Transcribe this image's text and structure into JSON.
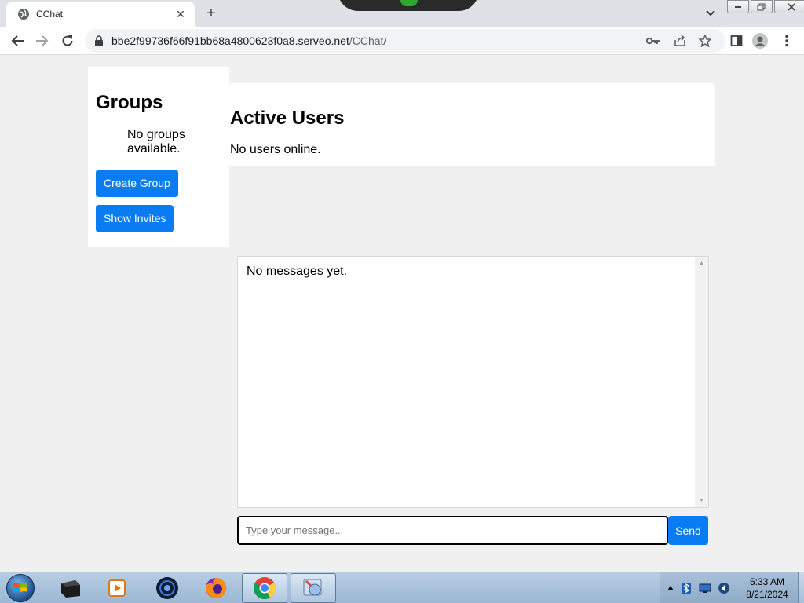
{
  "browser": {
    "tab_title": "CChat",
    "new_tab_label": "+",
    "close_tab_label": "✕",
    "url_host": "bbe2f99736f66f91bb68a4800623f0a8.serveo.net",
    "url_path": "/CChat/"
  },
  "groups": {
    "title": "Groups",
    "empty_text": "No groups available.",
    "create_button": "Create Group",
    "invites_button": "Show Invites"
  },
  "active_users": {
    "title": "Active Users",
    "empty_text": "No users online."
  },
  "messages": {
    "empty_text": "No messages yet."
  },
  "composer": {
    "placeholder": "Type your message...",
    "send_label": "Send"
  },
  "taskbar": {
    "time": "5:33 AM",
    "date": "8/21/2024"
  },
  "colors": {
    "accent": "#0a7cf3",
    "page_bg": "#f0f0f0"
  }
}
